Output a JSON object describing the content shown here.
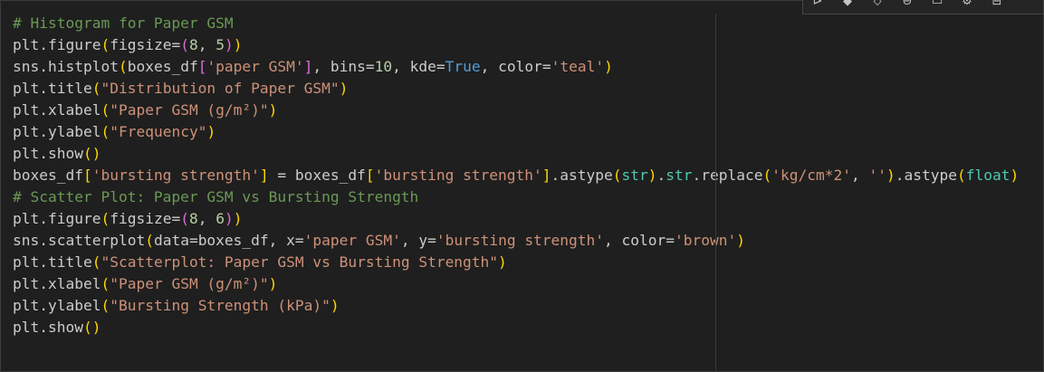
{
  "editor": {
    "code_lines": [
      [
        {
          "t": "# Histogram for Paper GSM",
          "k": "comment"
        }
      ],
      [
        {
          "t": "plt",
          "k": "var"
        },
        {
          "t": ".",
          "k": "op"
        },
        {
          "t": "figure",
          "k": "fn"
        },
        {
          "t": "(",
          "k": "paren1"
        },
        {
          "t": "figsize",
          "k": "param"
        },
        {
          "t": "=",
          "k": "op"
        },
        {
          "t": "(",
          "k": "paren2"
        },
        {
          "t": "8",
          "k": "num"
        },
        {
          "t": ", ",
          "k": "op"
        },
        {
          "t": "5",
          "k": "num"
        },
        {
          "t": ")",
          "k": "paren2"
        },
        {
          "t": ")",
          "k": "paren1"
        }
      ],
      [
        {
          "t": "sns",
          "k": "var"
        },
        {
          "t": ".",
          "k": "op"
        },
        {
          "t": "histplot",
          "k": "fn"
        },
        {
          "t": "(",
          "k": "paren1"
        },
        {
          "t": "boxes_df",
          "k": "var"
        },
        {
          "t": "[",
          "k": "paren2"
        },
        {
          "t": "'paper GSM'",
          "k": "str"
        },
        {
          "t": "]",
          "k": "paren2"
        },
        {
          "t": ", ",
          "k": "op"
        },
        {
          "t": "bins",
          "k": "param"
        },
        {
          "t": "=",
          "k": "op"
        },
        {
          "t": "10",
          "k": "num"
        },
        {
          "t": ", ",
          "k": "op"
        },
        {
          "t": "kde",
          "k": "param"
        },
        {
          "t": "=",
          "k": "op"
        },
        {
          "t": "True",
          "k": "kw"
        },
        {
          "t": ", ",
          "k": "op"
        },
        {
          "t": "color",
          "k": "param"
        },
        {
          "t": "=",
          "k": "op"
        },
        {
          "t": "'teal'",
          "k": "str"
        },
        {
          "t": ")",
          "k": "paren1"
        }
      ],
      [
        {
          "t": "plt",
          "k": "var"
        },
        {
          "t": ".",
          "k": "op"
        },
        {
          "t": "title",
          "k": "fn"
        },
        {
          "t": "(",
          "k": "paren1"
        },
        {
          "t": "\"Distribution of Paper GSM\"",
          "k": "str"
        },
        {
          "t": ")",
          "k": "paren1"
        }
      ],
      [
        {
          "t": "plt",
          "k": "var"
        },
        {
          "t": ".",
          "k": "op"
        },
        {
          "t": "xlabel",
          "k": "fn"
        },
        {
          "t": "(",
          "k": "paren1"
        },
        {
          "t": "\"Paper GSM (g/m²)\"",
          "k": "str"
        },
        {
          "t": ")",
          "k": "paren1"
        }
      ],
      [
        {
          "t": "plt",
          "k": "var"
        },
        {
          "t": ".",
          "k": "op"
        },
        {
          "t": "ylabel",
          "k": "fn"
        },
        {
          "t": "(",
          "k": "paren1"
        },
        {
          "t": "\"Frequency\"",
          "k": "str"
        },
        {
          "t": ")",
          "k": "paren1"
        }
      ],
      [
        {
          "t": "plt",
          "k": "var"
        },
        {
          "t": ".",
          "k": "op"
        },
        {
          "t": "show",
          "k": "fn"
        },
        {
          "t": "(",
          "k": "paren1"
        },
        {
          "t": ")",
          "k": "paren1"
        }
      ],
      [
        {
          "t": "boxes_df",
          "k": "var"
        },
        {
          "t": "[",
          "k": "paren1"
        },
        {
          "t": "'bursting strength'",
          "k": "str"
        },
        {
          "t": "]",
          "k": "paren1"
        },
        {
          "t": " = ",
          "k": "op"
        },
        {
          "t": "boxes_df",
          "k": "var"
        },
        {
          "t": "[",
          "k": "paren1"
        },
        {
          "t": "'bursting strength'",
          "k": "str"
        },
        {
          "t": "]",
          "k": "paren1"
        },
        {
          "t": ".",
          "k": "op"
        },
        {
          "t": "astype",
          "k": "fn"
        },
        {
          "t": "(",
          "k": "paren1"
        },
        {
          "t": "str",
          "k": "builtin"
        },
        {
          "t": ")",
          "k": "paren1"
        },
        {
          "t": ".",
          "k": "op"
        },
        {
          "t": "str",
          "k": "builtin"
        },
        {
          "t": ".",
          "k": "op"
        },
        {
          "t": "replace",
          "k": "fn"
        },
        {
          "t": "(",
          "k": "paren1"
        },
        {
          "t": "'kg/cm*2'",
          "k": "str"
        },
        {
          "t": ", ",
          "k": "op"
        },
        {
          "t": "''",
          "k": "str"
        },
        {
          "t": ")",
          "k": "paren1"
        },
        {
          "t": ".",
          "k": "op"
        },
        {
          "t": "astype",
          "k": "fn"
        },
        {
          "t": "(",
          "k": "paren1"
        },
        {
          "t": "float",
          "k": "builtin"
        },
        {
          "t": ")",
          "k": "paren1"
        }
      ],
      [
        {
          "t": "# Scatter Plot: Paper GSM vs Bursting Strength",
          "k": "comment"
        }
      ],
      [
        {
          "t": "plt",
          "k": "var"
        },
        {
          "t": ".",
          "k": "op"
        },
        {
          "t": "figure",
          "k": "fn"
        },
        {
          "t": "(",
          "k": "paren1"
        },
        {
          "t": "figsize",
          "k": "param"
        },
        {
          "t": "=",
          "k": "op"
        },
        {
          "t": "(",
          "k": "paren2"
        },
        {
          "t": "8",
          "k": "num"
        },
        {
          "t": ", ",
          "k": "op"
        },
        {
          "t": "6",
          "k": "num"
        },
        {
          "t": ")",
          "k": "paren2"
        },
        {
          "t": ")",
          "k": "paren1"
        }
      ],
      [
        {
          "t": "sns",
          "k": "var"
        },
        {
          "t": ".",
          "k": "op"
        },
        {
          "t": "scatterplot",
          "k": "fn"
        },
        {
          "t": "(",
          "k": "paren1"
        },
        {
          "t": "data",
          "k": "param"
        },
        {
          "t": "=",
          "k": "op"
        },
        {
          "t": "boxes_df",
          "k": "var"
        },
        {
          "t": ", ",
          "k": "op"
        },
        {
          "t": "x",
          "k": "param"
        },
        {
          "t": "=",
          "k": "op"
        },
        {
          "t": "'paper GSM'",
          "k": "str"
        },
        {
          "t": ", ",
          "k": "op"
        },
        {
          "t": "y",
          "k": "param"
        },
        {
          "t": "=",
          "k": "op"
        },
        {
          "t": "'bursting strength'",
          "k": "str"
        },
        {
          "t": ", ",
          "k": "op"
        },
        {
          "t": "color",
          "k": "param"
        },
        {
          "t": "=",
          "k": "op"
        },
        {
          "t": "'brown'",
          "k": "str"
        },
        {
          "t": ")",
          "k": "paren1"
        }
      ],
      [
        {
          "t": "plt",
          "k": "var"
        },
        {
          "t": ".",
          "k": "op"
        },
        {
          "t": "title",
          "k": "fn"
        },
        {
          "t": "(",
          "k": "paren1"
        },
        {
          "t": "\"Scatterplot: Paper GSM vs Bursting Strength\"",
          "k": "str"
        },
        {
          "t": ")",
          "k": "paren1"
        }
      ],
      [
        {
          "t": "plt",
          "k": "var"
        },
        {
          "t": ".",
          "k": "op"
        },
        {
          "t": "xlabel",
          "k": "fn"
        },
        {
          "t": "(",
          "k": "paren1"
        },
        {
          "t": "\"Paper GSM (g/m²)\"",
          "k": "str"
        },
        {
          "t": ")",
          "k": "paren1"
        }
      ],
      [
        {
          "t": "plt",
          "k": "var"
        },
        {
          "t": ".",
          "k": "op"
        },
        {
          "t": "ylabel",
          "k": "fn"
        },
        {
          "t": "(",
          "k": "paren1"
        },
        {
          "t": "\"Bursting Strength (kPa)\"",
          "k": "str"
        },
        {
          "t": ")",
          "k": "paren1"
        }
      ],
      [
        {
          "t": "plt",
          "k": "var"
        },
        {
          "t": ".",
          "k": "op"
        },
        {
          "t": "show",
          "k": "fn"
        },
        {
          "t": "(",
          "k": "paren1"
        },
        {
          "t": ")",
          "k": "paren1"
        }
      ]
    ]
  },
  "cell_toolbar": {
    "buttons": [
      {
        "name": "run-above-icon",
        "glyph": "⊳"
      },
      {
        "name": "run-below-icon",
        "glyph": "◆"
      },
      {
        "name": "split-cell-icon",
        "glyph": "⬦"
      },
      {
        "name": "link-icon",
        "glyph": "⊖"
      },
      {
        "name": "comment-icon",
        "glyph": "▭"
      },
      {
        "name": "gear-icon",
        "glyph": "⚙"
      },
      {
        "name": "delete-icon",
        "glyph": "⊟"
      }
    ]
  }
}
